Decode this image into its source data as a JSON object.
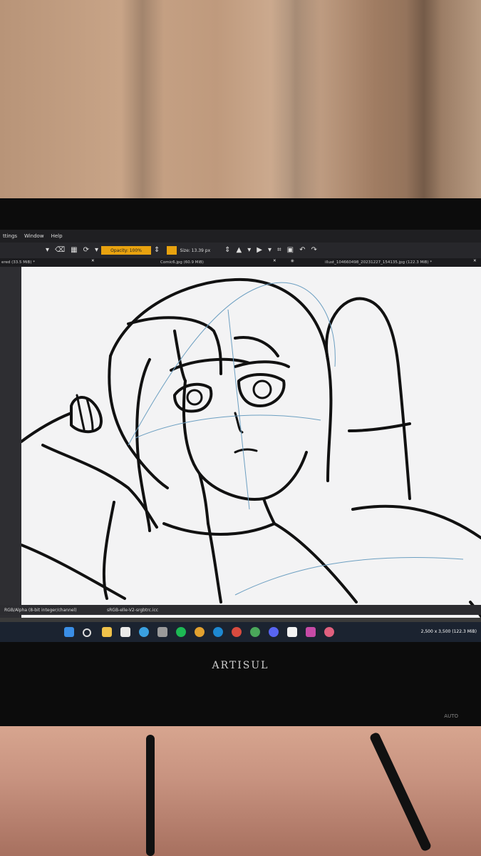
{
  "app": {
    "menu": [
      "ttings",
      "Window",
      "Help"
    ],
    "toolbar": {
      "opacity_label": "Opacity: 100%",
      "brush_color": "#e8a20f",
      "size_label": "Size: 13.39 px"
    },
    "tabs": [
      {
        "label": "ered (33.5 MiB) *"
      },
      {
        "label": "Comic6.jpg (60.9 MiB)"
      },
      {
        "label": "illust_104660498_20231227_154135.jpg (122.3 MiB) *"
      }
    ],
    "status": {
      "color_mode": "RGB/Alpha (8-bit integer/channel)",
      "profile": "sRGB-elle-V2-srgbtrc.icc",
      "dimensions": "2,500 x 3,500 (122.3 MiB)"
    }
  },
  "taskbar": {
    "icons": [
      "windows-start-icon",
      "search-icon",
      "file-explorer-icon",
      "store-icon",
      "telegram-icon",
      "usb-icon",
      "spotify-icon",
      "chrome-icon",
      "cortana-icon",
      "chrome-icon",
      "chrome-icon",
      "discord-icon",
      "ibis-paint-icon",
      "affinity-icon",
      "krita-icon"
    ]
  },
  "monitor": {
    "brand": "ARTISUL",
    "auto_label": "AUTO"
  }
}
